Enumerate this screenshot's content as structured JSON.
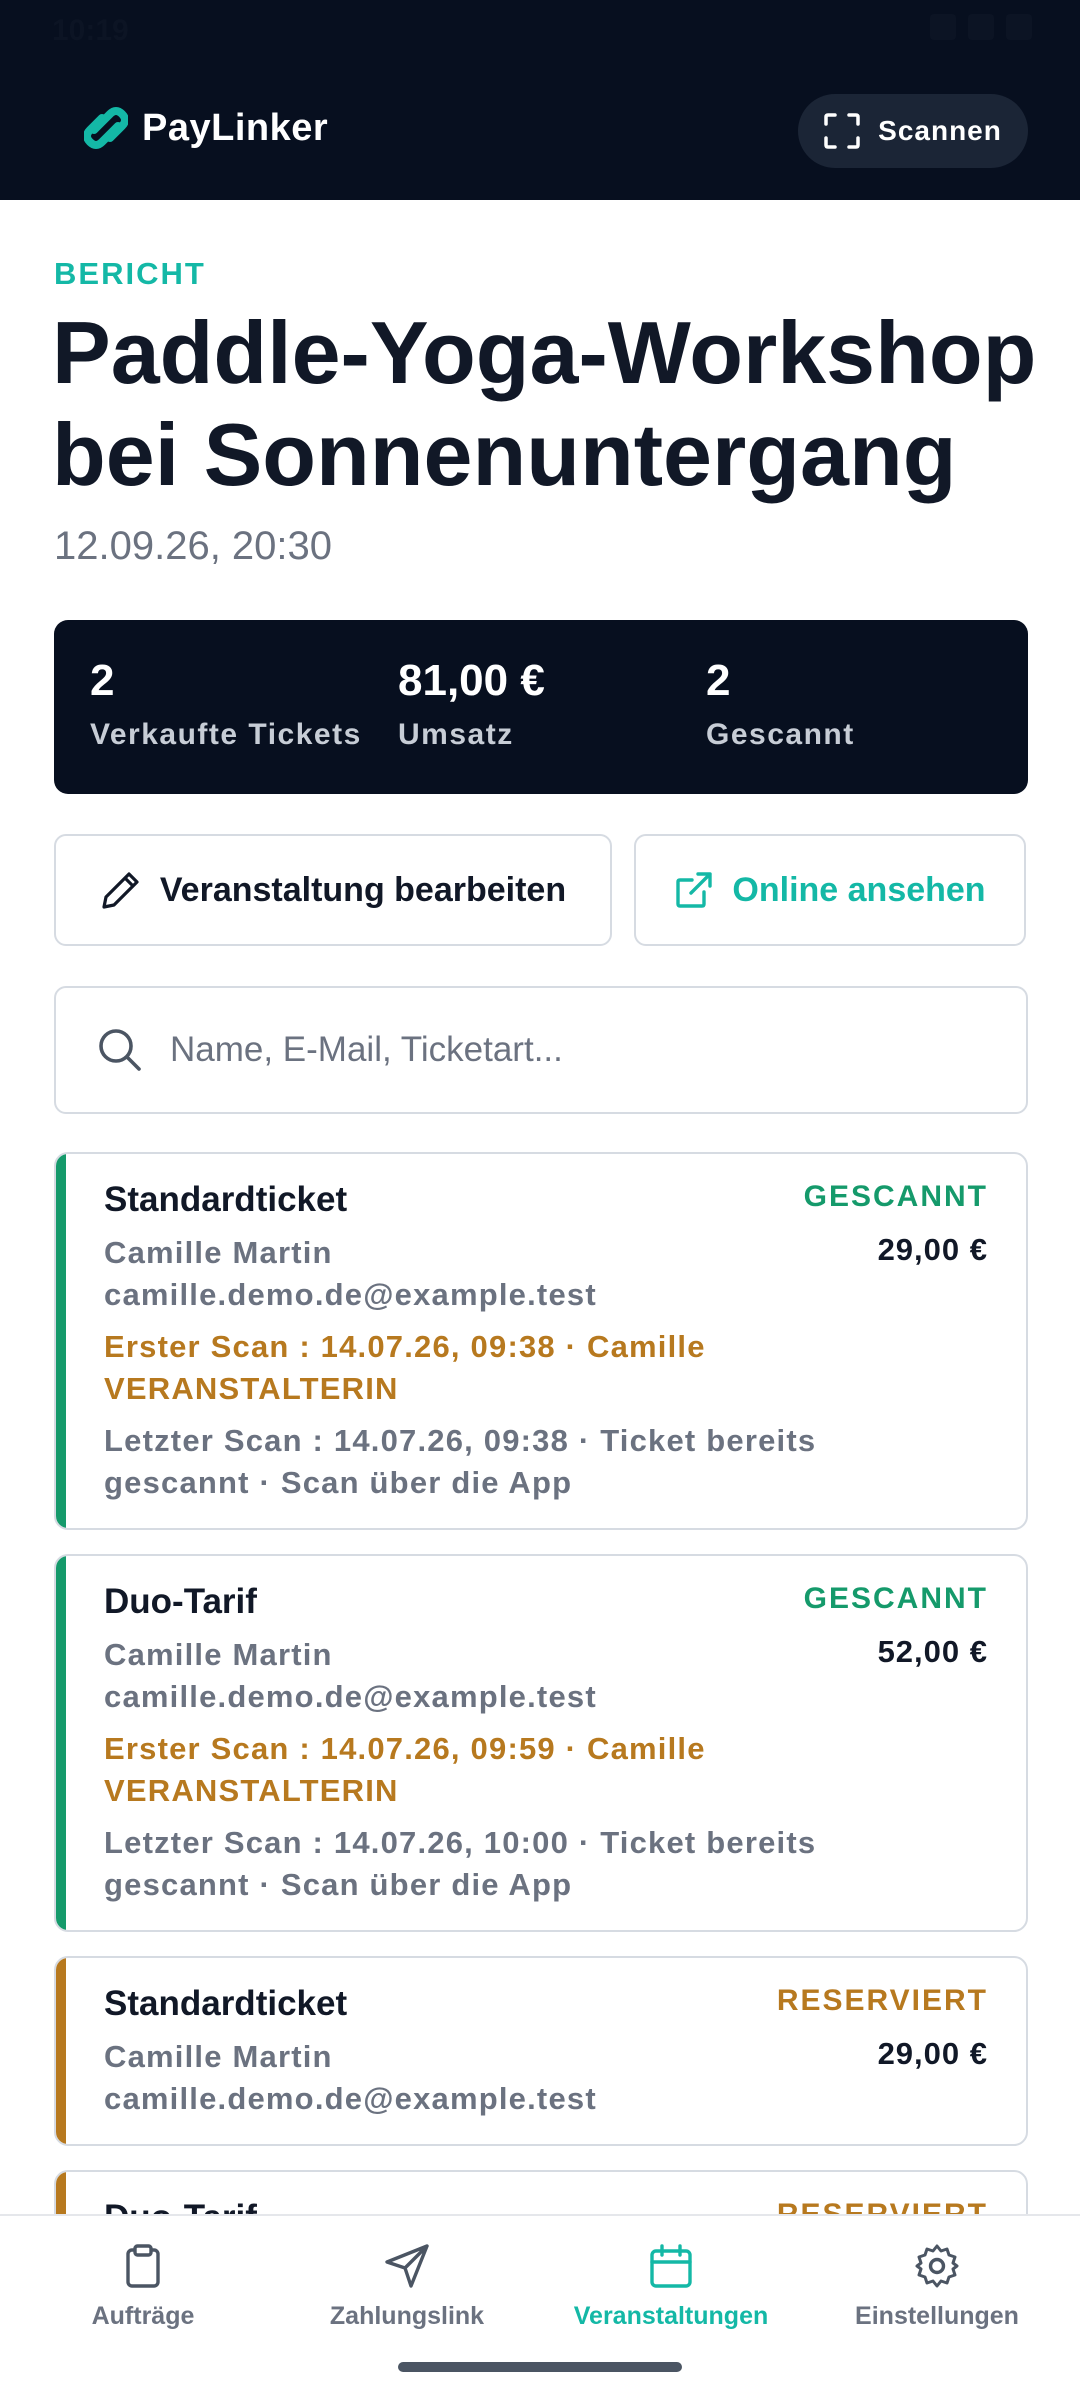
{
  "status_bar": {
    "time": "10:19"
  },
  "header": {
    "app_name": "PayLinker",
    "scan_label": "Scannen"
  },
  "event": {
    "eyebrow": "BERICHT",
    "title": "Paddle-Yoga-Workshop bei Sonnenuntergang",
    "date": "12.09.26, 20:30"
  },
  "stats": [
    {
      "value": "2",
      "label": "Verkaufte Tickets"
    },
    {
      "value": "81,00 €",
      "label": "Umsatz"
    },
    {
      "value": "2",
      "label": "Gescannt"
    }
  ],
  "actions": {
    "edit_label": "Veranstaltung bearbeiten",
    "online_label": "Online ansehen"
  },
  "search": {
    "placeholder": "Name, E-Mail, Ticketart..."
  },
  "tickets": [
    {
      "type": "Standardticket",
      "status": "GESCANNT",
      "price": "29,00 €",
      "name": "Camille Martin",
      "email": "camille.demo.de@example.test",
      "first_scan": "Erster Scan : 14.07.26, 09:38 · Camille VERANSTALTERIN",
      "last_scan": "Letzter Scan : 14.07.26, 09:38 · Ticket bereits gescannt · Scan über die App"
    },
    {
      "type": "Duo-Tarif",
      "status": "GESCANNT",
      "price": "52,00 €",
      "name": "Camille Martin",
      "email": "camille.demo.de@example.test",
      "first_scan": "Erster Scan : 14.07.26, 09:59 · Camille VERANSTALTERIN",
      "last_scan": "Letzter Scan : 14.07.26, 10:00 · Ticket bereits gescannt · Scan über die App"
    },
    {
      "type": "Standardticket",
      "status": "RESERVIERT",
      "price": "29,00 €",
      "name": "Camille Martin",
      "email": "camille.demo.de@example.test"
    },
    {
      "type": "Duo-Tarif",
      "status": "RESERVIERT"
    }
  ],
  "nav": [
    {
      "label": "Aufträge",
      "icon": "clipboard-icon"
    },
    {
      "label": "Zahlungslink",
      "icon": "send-icon"
    },
    {
      "label": "Veranstaltungen",
      "icon": "calendar-icon",
      "active": true
    },
    {
      "label": "Einstellungen",
      "icon": "gear-icon"
    }
  ],
  "colors": {
    "accent": "#14b8a6",
    "header_bg": "#070f1f",
    "scanned": "#159a6b",
    "reserved": "#b7791f",
    "muted": "#6b7280"
  }
}
